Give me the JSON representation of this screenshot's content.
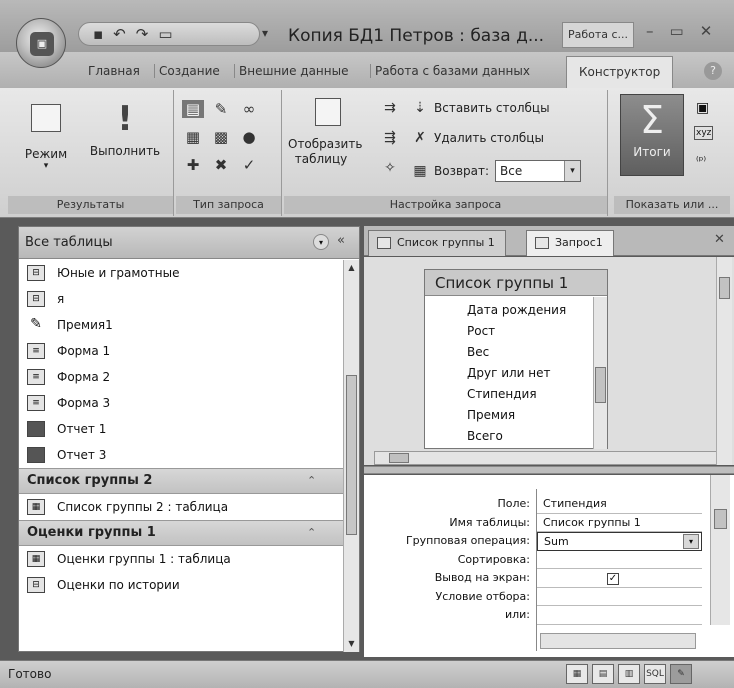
{
  "window": {
    "title": "Копия БД1 Петров : база д...",
    "context_tab": "Работа с...",
    "office_logo": "office-logo",
    "qat_icons": [
      "save-icon",
      "undo-icon",
      "redo-icon",
      "new-icon"
    ]
  },
  "ribbon_tabs": [
    {
      "label": "Главная",
      "active": false
    },
    {
      "label": "Создание",
      "active": false
    },
    {
      "label": "Внешние данные",
      "active": false
    },
    {
      "label": "Работа с базами данных",
      "active": false
    },
    {
      "label": "Конструктор",
      "active": true
    }
  ],
  "ribbon": {
    "results": {
      "label": "Результаты",
      "mode_label": "Режим",
      "run_label": "Выполнить"
    },
    "query_type": {
      "label": "Тип запроса"
    },
    "query_setup": {
      "label": "Настройка запроса",
      "show_table_label": "Отобразить таблицу",
      "insert_columns": "Вставить столбцы",
      "delete_columns": "Удалить столбцы",
      "return_label": "Возврат:",
      "return_value": "Все"
    },
    "show_hide": {
      "label": "Показать или ...",
      "totals_label": "Итоги"
    }
  },
  "nav": {
    "title": "Все таблицы",
    "items_top": [
      {
        "label": "Юные и грамотные",
        "icon": "query-icon"
      },
      {
        "label": "я",
        "icon": "query-icon"
      },
      {
        "label": "Премия1",
        "icon": "update-query-icon"
      },
      {
        "label": "Форма 1",
        "icon": "form-icon"
      },
      {
        "label": "Форма 2",
        "icon": "form-icon"
      },
      {
        "label": "Форма 3",
        "icon": "form-icon"
      },
      {
        "label": "Отчет 1",
        "icon": "report-icon"
      },
      {
        "label": "Отчет 3",
        "icon": "report-icon"
      }
    ],
    "group1": {
      "label": "Список группы 2",
      "items": [
        {
          "label": "Список группы 2 : таблица",
          "icon": "table-icon"
        }
      ]
    },
    "group2": {
      "label": "Оценки группы 1",
      "items": [
        {
          "label": "Оценки группы 1 : таблица",
          "icon": "table-icon"
        },
        {
          "label": "Оценки по истории",
          "icon": "query-icon"
        }
      ]
    }
  },
  "doc_tabs": [
    {
      "label": "Список группы 1",
      "active": false
    },
    {
      "label": "Запрос1",
      "active": true
    }
  ],
  "field_list": {
    "title": "Список группы 1",
    "fields": [
      "Дата рождения",
      "Рост",
      "Вес",
      "Друг или нет",
      "Стипендия",
      "Премия",
      "Всего"
    ]
  },
  "grid": {
    "labels": [
      "Поле:",
      "Имя таблицы:",
      "Групповая операция:",
      "Сортировка:",
      "Вывод на экран:",
      "Условие отбора:",
      "или:"
    ],
    "field": "Стипендия",
    "table": "Список группы 1",
    "group_op": "Sum",
    "sort": "",
    "show": true,
    "criteria": "",
    "or": ""
  },
  "status": {
    "text": "Готово",
    "view_sql": "SQL"
  }
}
